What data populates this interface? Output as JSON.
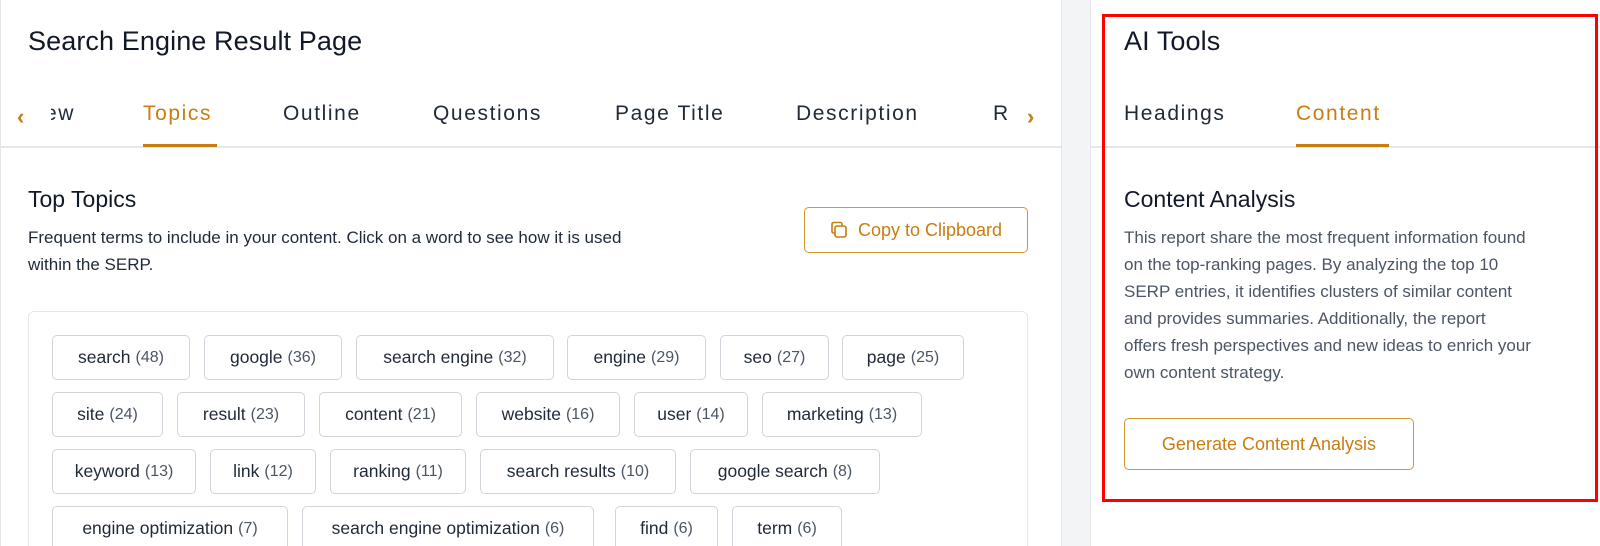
{
  "left": {
    "title": "Search Engine Result Page",
    "tabs": [
      "ew",
      "Topics",
      "Outline",
      "Questions",
      "Page Title",
      "Description",
      "R"
    ],
    "prev_arrow": "‹",
    "next_arrow": "›",
    "section_title": "Top Topics",
    "description_line1": "Frequent terms to include in your content. Click on a word to see how it is used",
    "description_line2": "within the SERP.",
    "copy_button": "Copy to Clipboard",
    "chips": [
      {
        "term": "search",
        "count": "(48)"
      },
      {
        "term": "google",
        "count": "(36)"
      },
      {
        "term": "search engine",
        "count": "(32)"
      },
      {
        "term": "engine",
        "count": "(29)"
      },
      {
        "term": "seo",
        "count": "(27)"
      },
      {
        "term": "page",
        "count": "(25)"
      },
      {
        "term": "site",
        "count": "(24)"
      },
      {
        "term": "result",
        "count": "(23)"
      },
      {
        "term": "content",
        "count": "(21)"
      },
      {
        "term": "website",
        "count": "(16)"
      },
      {
        "term": "user",
        "count": "(14)"
      },
      {
        "term": "marketing",
        "count": "(13)"
      },
      {
        "term": "keyword",
        "count": "(13)"
      },
      {
        "term": "link",
        "count": "(12)"
      },
      {
        "term": "ranking",
        "count": "(11)"
      },
      {
        "term": "search results",
        "count": "(10)"
      },
      {
        "term": "google search",
        "count": "(8)"
      },
      {
        "term": "engine optimization",
        "count": "(7)"
      },
      {
        "term": "search engine optimization",
        "count": "(6)"
      },
      {
        "term": "find",
        "count": "(6)"
      },
      {
        "term": "term",
        "count": "(6)"
      }
    ]
  },
  "right": {
    "title": "AI Tools",
    "tabs": [
      "Headings",
      "Content"
    ],
    "section_title": "Content Analysis",
    "description_lines": [
      "This report share the most frequent information found",
      "on the top-ranking pages. By analyzing the top 10",
      "SERP entries, it identifies clusters of similar content",
      "and provides summaries. Additionally, the report",
      "offers fresh perspectives and new ideas to enrich your",
      "own content strategy."
    ],
    "generate_button": "Generate Content Analysis"
  },
  "colors": {
    "accent": "#c97d10",
    "highlight_box": "#ff0000"
  }
}
